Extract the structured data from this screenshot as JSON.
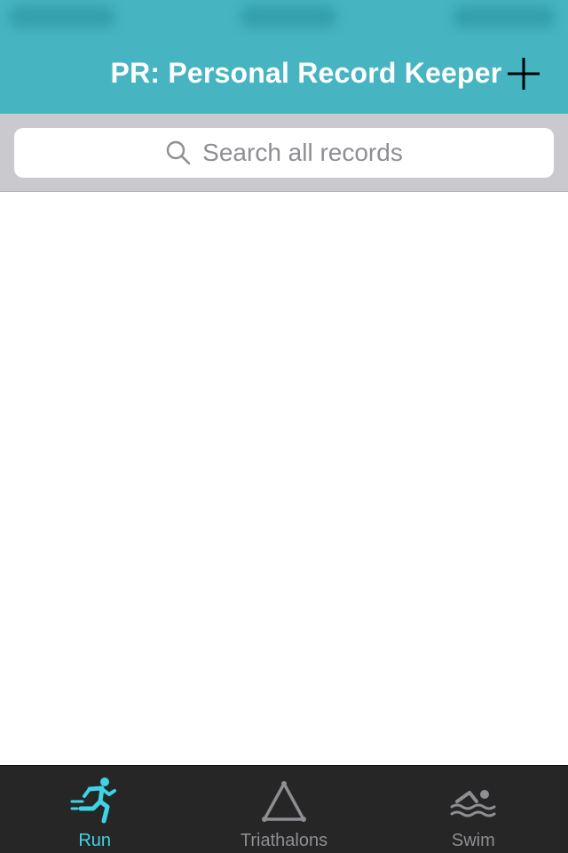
{
  "navigation": {
    "title": "PR: Personal Record Keeper",
    "add_icon": "plus-icon"
  },
  "search": {
    "placeholder": "Search all records",
    "icon": "magnifier-icon"
  },
  "tabs": [
    {
      "label": "Run",
      "icon": "runner-icon",
      "selected": true
    },
    {
      "label": "Triathalons",
      "icon": "triangle-icon",
      "selected": false
    },
    {
      "label": "Swim",
      "icon": "swimmer-icon",
      "selected": false
    }
  ],
  "colors": {
    "accent": "#46b5c1",
    "tab_selected": "#3fd3e6",
    "tab_unselected": "#8e8e93",
    "tab_bar": "#262626"
  }
}
